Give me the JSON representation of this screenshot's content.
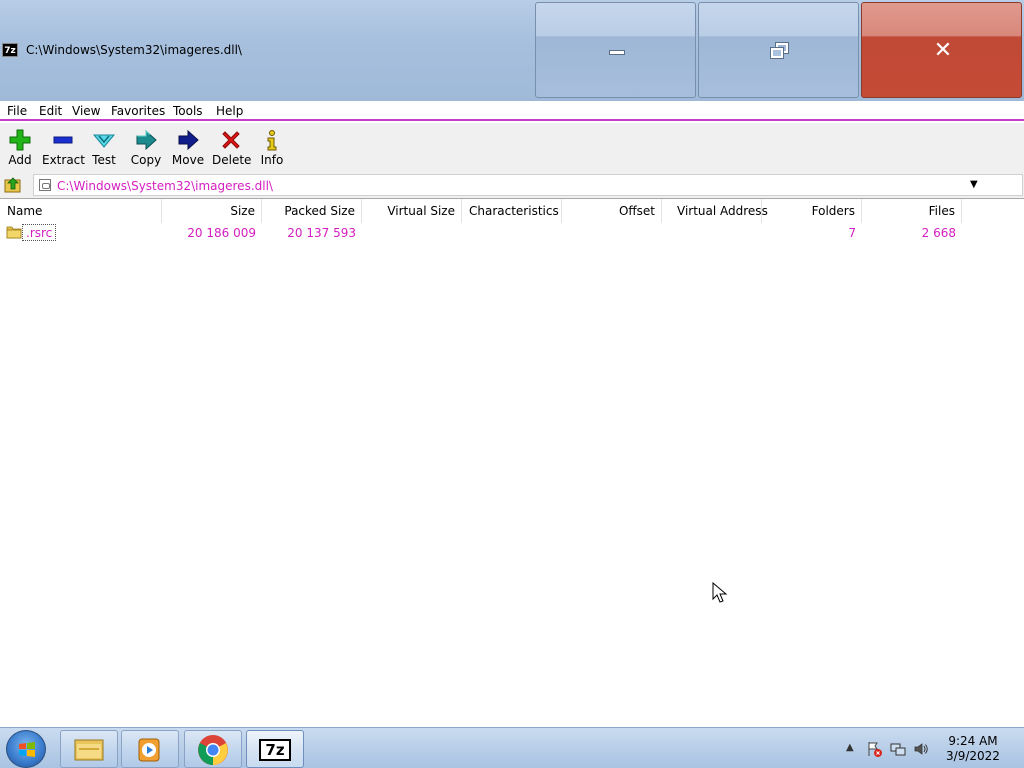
{
  "window": {
    "title": "C:\\Windows\\System32\\imageres.dll\\",
    "app_icon_text": "7z"
  },
  "menu": [
    "File",
    "Edit",
    "View",
    "Favorites",
    "Tools",
    "Help"
  ],
  "toolbar": {
    "add": "Add",
    "extract": "Extract",
    "test": "Test",
    "copy": "Copy",
    "move": "Move",
    "delete": "Delete",
    "info": "Info"
  },
  "address": {
    "path": "C:\\Windows\\System32\\imageres.dll\\"
  },
  "columns": {
    "name": "Name",
    "size": "Size",
    "packed_size": "Packed Size",
    "virtual_size": "Virtual Size",
    "characteristics": "Characteristics",
    "offset": "Offset",
    "virtual_address": "Virtual Address",
    "folders": "Folders",
    "files": "Files"
  },
  "rows": [
    {
      "name": ".rsrc",
      "size": "20 186 009",
      "packed_size": "20 137 593",
      "virtual_size": "",
      "characteristics": "",
      "offset": "",
      "virtual_address": "",
      "folders": "7",
      "files": "2 668"
    }
  ],
  "taskbar": {
    "time": "9:24 AM",
    "date": "3/9/2022",
    "seven_zip_label": "7z"
  },
  "colors": {
    "accent": "#d41ec0",
    "close_button": "#c44b36",
    "titlebar": "#a7c0de"
  },
  "icons": [
    "add-icon",
    "extract-icon",
    "test-icon",
    "copy-icon",
    "move-icon",
    "delete-icon",
    "info-icon",
    "folder-icon",
    "up-folder-icon"
  ]
}
